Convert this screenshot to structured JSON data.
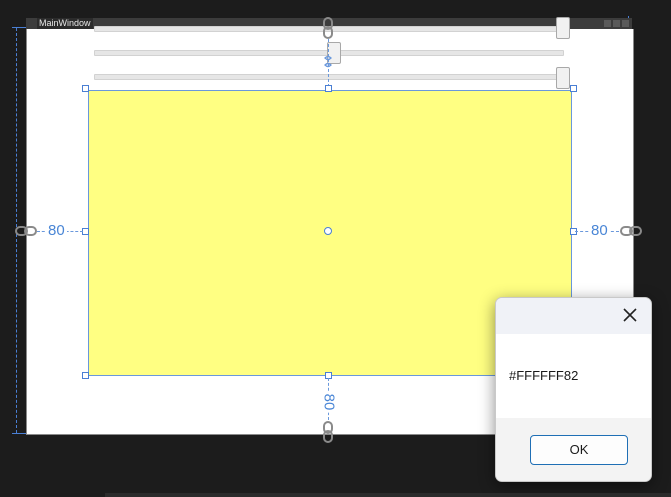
{
  "window": {
    "title": "MainWindow"
  },
  "layout_margins": {
    "left": "80",
    "right": "80",
    "bottom": "80"
  },
  "rectangle": {
    "fill_color": "#FFFFFF82"
  },
  "sliders": [
    {
      "name": "slider-1",
      "value_fraction": 1.0
    },
    {
      "name": "slider-2",
      "value_fraction": 0.5
    },
    {
      "name": "slider-3",
      "value_fraction": 1.0
    }
  ],
  "dialog": {
    "message": "#FFFFFF82",
    "ok_label": "OK"
  },
  "colors": {
    "rectangle_fill": "#ffff82",
    "selection_accent": "#4a7fd4",
    "ok_border": "#1f6fb5"
  },
  "icons": {
    "close": "close-icon",
    "margin_link": "link-chain-icon"
  }
}
